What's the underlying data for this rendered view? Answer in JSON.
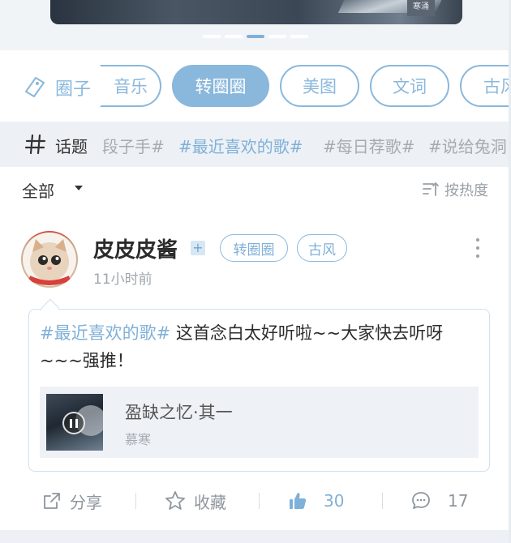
{
  "banner": {
    "stamp_text": "寒涌",
    "page_indicator": {
      "count": 5,
      "active_index": 2
    }
  },
  "categories": {
    "label": "圈子",
    "items": [
      {
        "label": "音乐",
        "active": false
      },
      {
        "label": "转圈圈",
        "active": true
      },
      {
        "label": "美图",
        "active": false
      },
      {
        "label": "文词",
        "active": false
      },
      {
        "label": "古风",
        "active": false
      }
    ]
  },
  "topics": {
    "label": "话题",
    "items": [
      {
        "label": "段子手#",
        "highlight": false
      },
      {
        "label": "#最近喜欢的歌#",
        "highlight": true
      },
      {
        "label": "#每日荐歌#",
        "highlight": false
      },
      {
        "label": "#说给兔洞",
        "highlight": false
      }
    ]
  },
  "filter": {
    "scope": "全部",
    "sort": "按热度"
  },
  "post": {
    "username": "皮皮皮酱",
    "plus": "+",
    "tags": [
      "转圈圈",
      "古风"
    ],
    "time": "11小时前",
    "hashtag": "#最近喜欢的歌#",
    "text": " 这首念白太好听啦~~大家快去听呀~~~强推！",
    "song": {
      "title": "盈缺之忆·其一",
      "artist": "慕寒"
    },
    "actions": {
      "share": "分享",
      "favorite": "收藏",
      "likes": "30",
      "comments": "17"
    }
  },
  "colors": {
    "accent": "#8ab8dc",
    "topic_bg": "#edf1f5",
    "text": "#2b2b2b",
    "muted": "#9aa0a6"
  }
}
